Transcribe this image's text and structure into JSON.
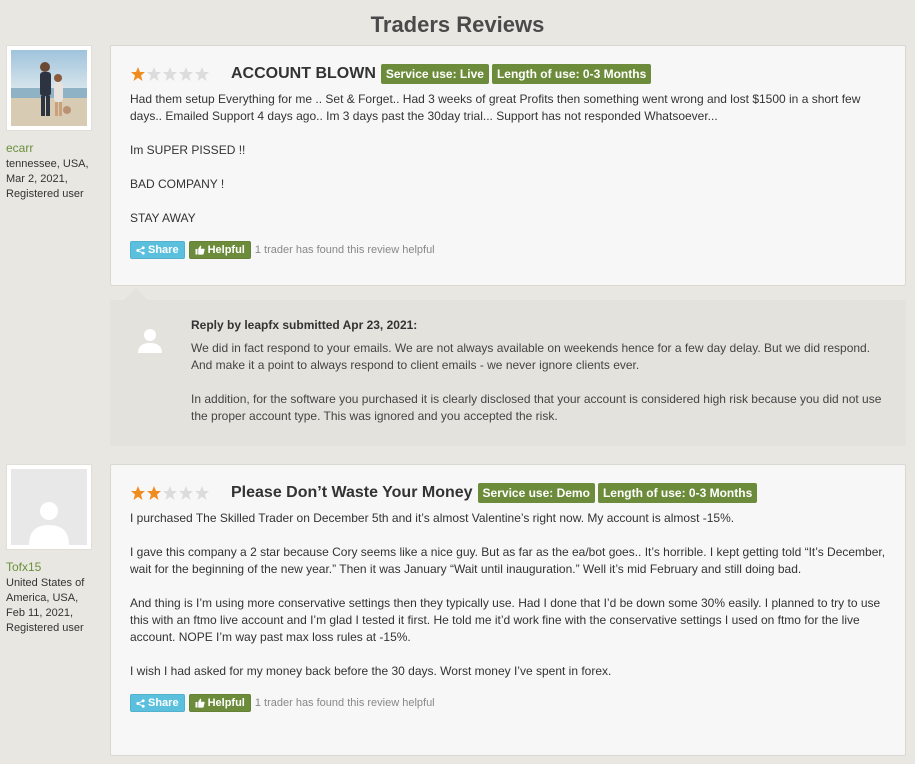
{
  "page": {
    "title": "Traders Reviews"
  },
  "reviews": [
    {
      "user": {
        "name": "ecarr",
        "location": "tennessee, USA,",
        "date": "Mar 2, 2021,",
        "status": "Registered user"
      },
      "rating": 1,
      "title": "ACCOUNT BLOWN",
      "badges": [
        "Service use: Live",
        "Length of use: 0-3 Months"
      ],
      "paragraphs": [
        "Had them setup Everything for me .. Set & Forget.. Had 3 weeks of great Profits then something went wrong and lost $1500 in a short few days.. Emailed Support 4 days ago.. Im 3 days past the 30day trial... Support has not responded Whatsoever...",
        "Im SUPER PISSED !!",
        "BAD COMPANY !",
        "STAY AWAY"
      ],
      "share_label": "Share",
      "helpful_label": "Helpful",
      "helpful_text": "1 trader has found this review helpful"
    },
    {
      "user": {
        "name": "Tofx15",
        "location": "United States of America, USA,",
        "date": "Feb 11, 2021,",
        "status": "Registered user"
      },
      "rating": 2,
      "title": "Please Don’t Waste Your Money",
      "badges": [
        "Service use: Demo",
        "Length of use: 0-3 Months"
      ],
      "paragraphs": [
        "I purchased The Skilled Trader on December 5th and it’s almost Valentine’s right now. My account is almost -15%.",
        "I gave this company a 2 star because Cory seems like a nice guy. But as far as the ea/bot goes.. It’s horrible. I kept getting told “It’s December, wait for the beginning of the new year.” Then it was January “Wait until inauguration.” Well it’s mid February and still doing bad.",
        "And thing is I’m using more conservative settings then they typically use. Had I done that I’d be down some 30% easily. I planned to try to use this with an ftmo live account and I’m glad I tested it first. He told me it’d work fine with the conservative settings I used on ftmo for the live account. NOPE I’m way past max loss rules at -15%.",
        "I wish I had asked for my money back before the 30 days. Worst money I’ve spent in forex."
      ],
      "share_label": "Share",
      "helpful_label": "Helpful",
      "helpful_text": "1 trader has found this review helpful"
    }
  ],
  "reply": {
    "heading": "Reply by leapfx submitted Apr 23, 2021:",
    "paragraphs": [
      "We did in fact respond to your emails. We are not always available on weekends hence for a few day delay. But we did respond. And make it a point to always respond to client emails - we never ignore clients ever.",
      "In addition, for the software you purchased it is clearly disclosed that your account is considered high risk because you did not use the proper account type. This was ignored and you accepted the risk."
    ]
  },
  "colors": {
    "star_on": "#f08c1e",
    "star_off": "#dcdcdc",
    "badge": "#6d8c3b",
    "share": "#5bc0de",
    "username": "#6a8f3c"
  },
  "icons": [
    "star-icon",
    "share-icon",
    "thumbs-up-icon",
    "user-silhouette-icon"
  ]
}
